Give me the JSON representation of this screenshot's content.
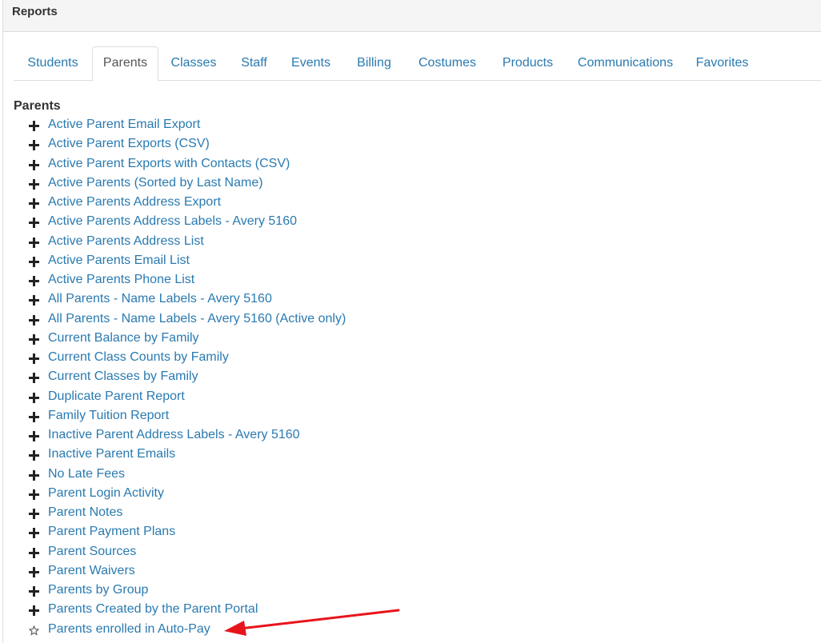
{
  "panel": {
    "title": "Reports"
  },
  "tabs": [
    {
      "label": "Students",
      "active": false
    },
    {
      "label": "Parents",
      "active": true
    },
    {
      "label": "Classes",
      "active": false
    },
    {
      "label": "Staff",
      "active": false
    },
    {
      "label": "Events",
      "active": false
    },
    {
      "label": "Billing",
      "active": false
    },
    {
      "label": "Costumes",
      "active": false
    },
    {
      "label": "Products",
      "active": false
    },
    {
      "label": "Communications",
      "active": false
    },
    {
      "label": "Favorites",
      "active": false
    }
  ],
  "section": {
    "title": "Parents"
  },
  "reports": [
    {
      "label": "Active Parent Email Export",
      "icon": "plus-icon"
    },
    {
      "label": "Active Parent Exports (CSV)",
      "icon": "plus-icon"
    },
    {
      "label": "Active Parent Exports with Contacts (CSV)",
      "icon": "plus-icon"
    },
    {
      "label": "Active Parents (Sorted by Last Name)",
      "icon": "plus-icon"
    },
    {
      "label": "Active Parents Address Export",
      "icon": "plus-icon"
    },
    {
      "label": "Active Parents Address Labels - Avery 5160",
      "icon": "plus-icon"
    },
    {
      "label": "Active Parents Address List",
      "icon": "plus-icon"
    },
    {
      "label": "Active Parents Email List",
      "icon": "plus-icon"
    },
    {
      "label": "Active Parents Phone List",
      "icon": "plus-icon"
    },
    {
      "label": "All Parents - Name Labels - Avery 5160",
      "icon": "plus-icon"
    },
    {
      "label": "All Parents - Name Labels - Avery 5160 (Active only)",
      "icon": "plus-icon"
    },
    {
      "label": "Current Balance by Family",
      "icon": "plus-icon"
    },
    {
      "label": "Current Class Counts by Family",
      "icon": "plus-icon"
    },
    {
      "label": "Current Classes by Family",
      "icon": "plus-icon"
    },
    {
      "label": "Duplicate Parent Report",
      "icon": "plus-icon"
    },
    {
      "label": "Family Tuition Report",
      "icon": "plus-icon"
    },
    {
      "label": "Inactive Parent Address Labels - Avery 5160",
      "icon": "plus-icon"
    },
    {
      "label": "Inactive Parent Emails",
      "icon": "plus-icon"
    },
    {
      "label": "No Late Fees",
      "icon": "plus-icon"
    },
    {
      "label": "Parent Login Activity",
      "icon": "plus-icon"
    },
    {
      "label": "Parent Notes",
      "icon": "plus-icon"
    },
    {
      "label": "Parent Payment Plans",
      "icon": "plus-icon"
    },
    {
      "label": "Parent Sources",
      "icon": "plus-icon"
    },
    {
      "label": "Parent Waivers",
      "icon": "plus-icon"
    },
    {
      "label": "Parents by Group",
      "icon": "plus-icon"
    },
    {
      "label": "Parents Created by the Parent Portal",
      "icon": "plus-icon"
    },
    {
      "label": "Parents enrolled in Auto-Pay",
      "icon": "star-icon"
    }
  ],
  "colors": {
    "link": "#2a7ab0",
    "annotation_arrow": "#e8141c"
  }
}
